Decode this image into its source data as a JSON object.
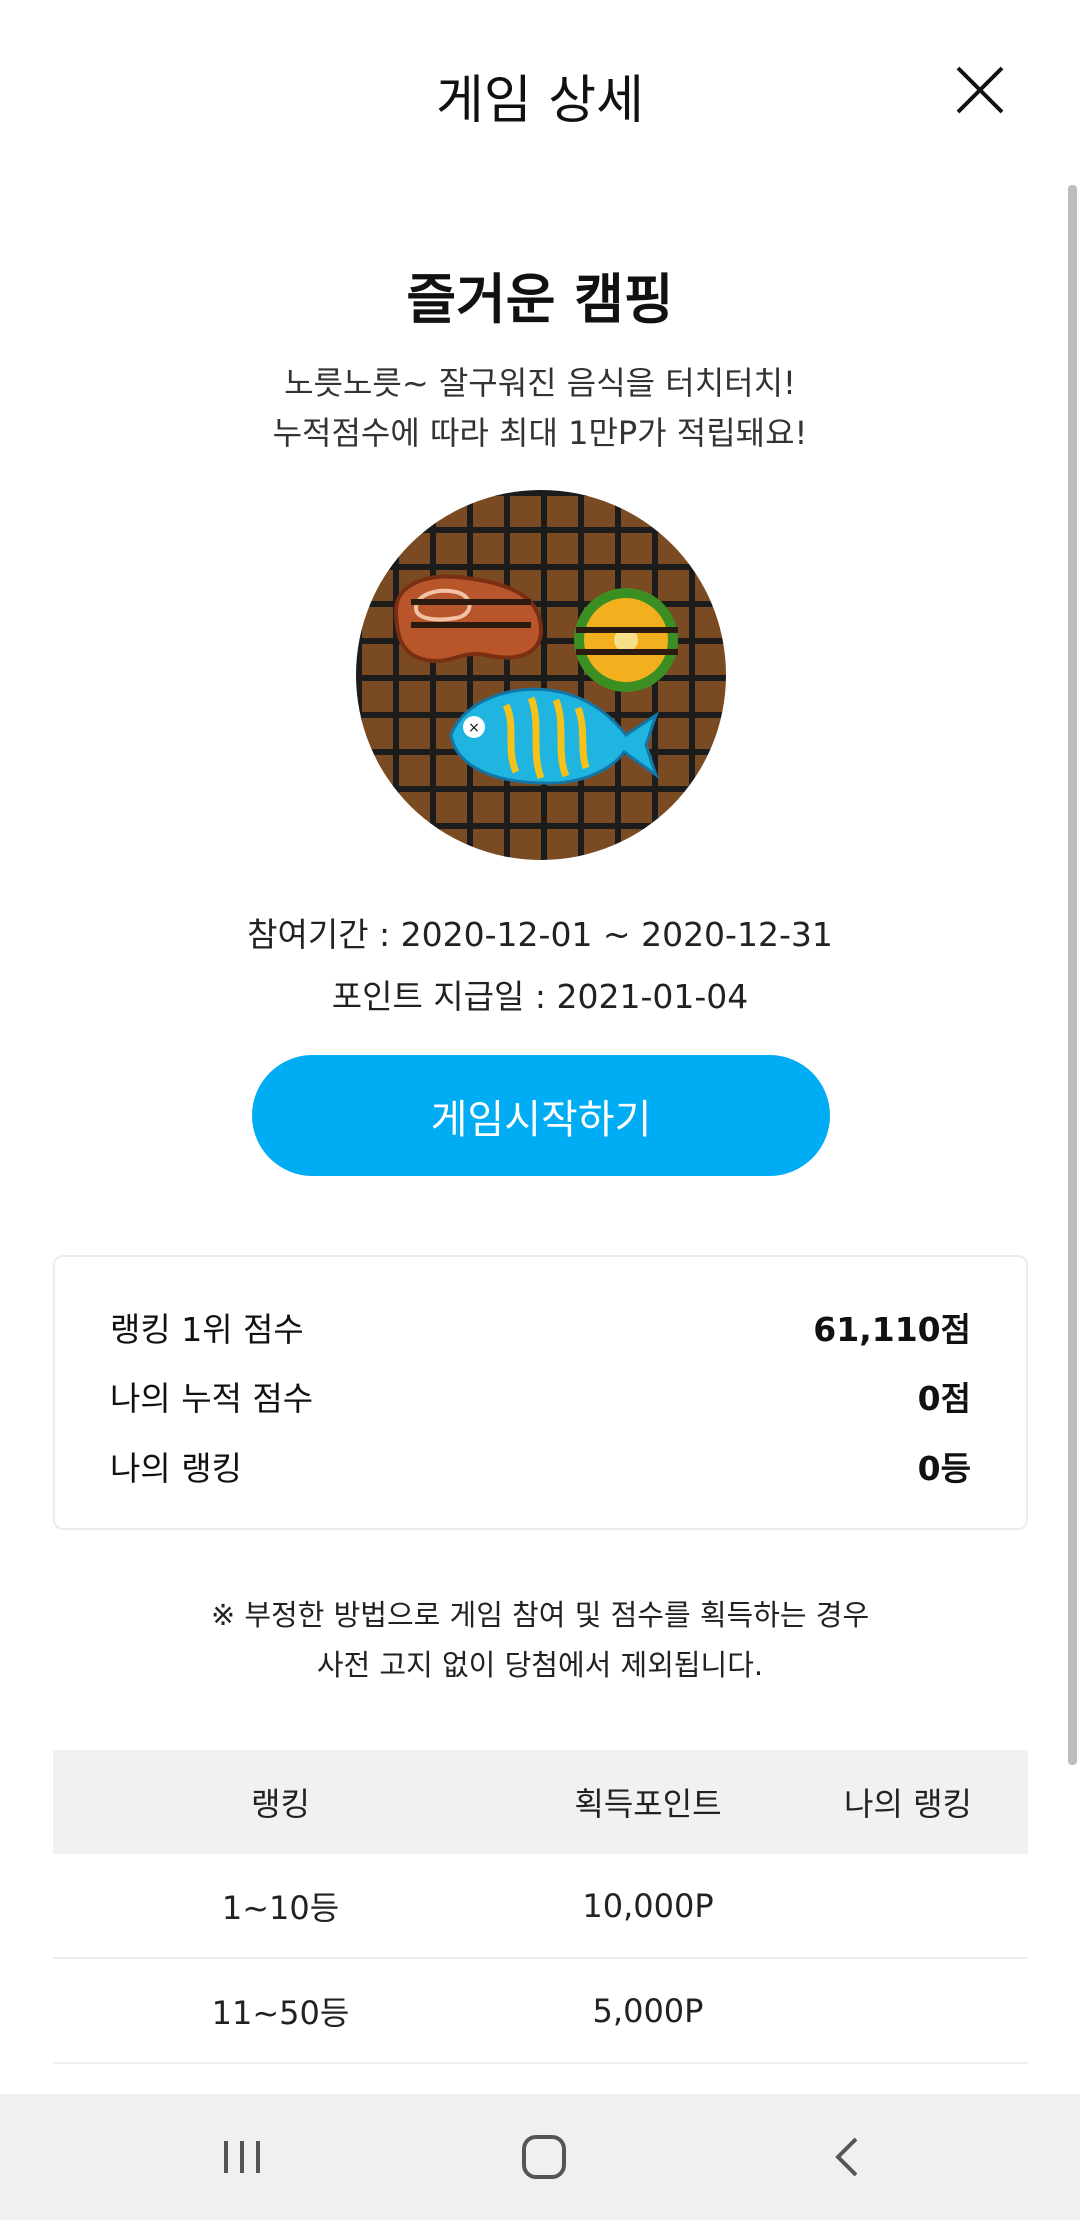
{
  "header": {
    "title": "게임 상세"
  },
  "game": {
    "title": "즐거운 캠핑",
    "description_line1": "노릇노릇~ 잘구워진 음식을 터치터치!",
    "description_line2": "누적점수에 따라 최대 1만P가 적립돼요!",
    "period": "참여기간 : 2020-12-01 ~ 2020-12-31",
    "payment_date": "포인트 지급일 : 2021-01-04",
    "start_button": "게임시작하기"
  },
  "scores": [
    {
      "label": "랭킹 1위 점수",
      "value": "61,110점"
    },
    {
      "label": "나의 누적 점수",
      "value": "0점"
    },
    {
      "label": "나의 랭킹",
      "value": "0등"
    }
  ],
  "notice": {
    "line1": "※ 부정한 방법으로 게임 참여 및 점수를 획득하는 경우",
    "line2": "사전 고지 없이 당첨에서 제외됩니다."
  },
  "rank_table": {
    "headers": [
      "랭킹",
      "획득포인트",
      "나의 랭킹"
    ],
    "rows": [
      {
        "rank": "1~10등",
        "points": "10,000P",
        "mine": ""
      },
      {
        "rank": "11~50등",
        "points": "5,000P",
        "mine": ""
      }
    ]
  },
  "colors": {
    "accent": "#00adf5",
    "grill": "#7a4a22"
  },
  "icons": {
    "close": "close-icon",
    "recent": "recent-apps-icon",
    "home": "home-icon",
    "back": "back-icon"
  }
}
